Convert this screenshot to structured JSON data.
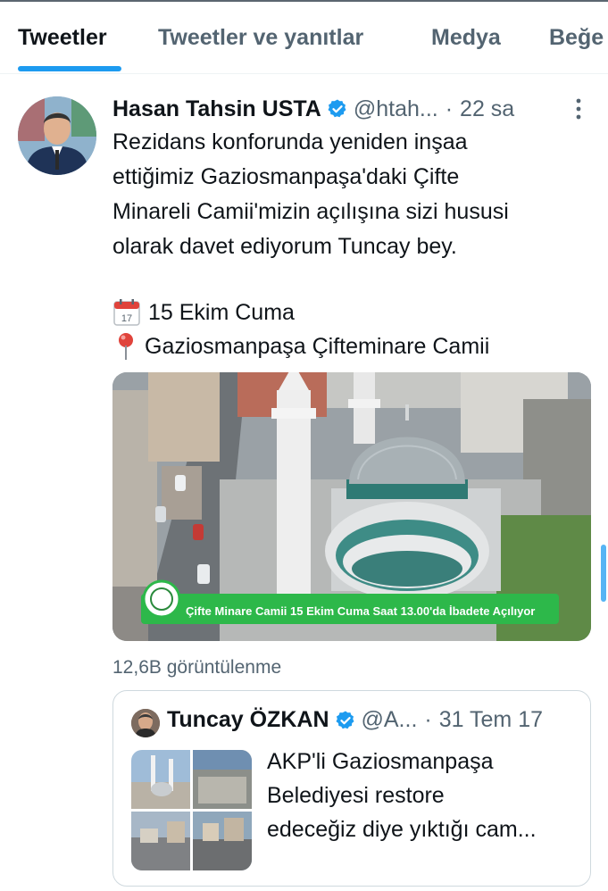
{
  "tabs": [
    {
      "label": "Tweetler"
    },
    {
      "label": "Tweetler ve yanıtlar"
    },
    {
      "label": "Medya"
    },
    {
      "label": "Beğe"
    }
  ],
  "tweet": {
    "author_name": "Hasan Tahsin USTA",
    "handle": "@htah...",
    "separator": "·",
    "time": "22 sa",
    "text_lines": [
      "Rezidans konforunda yeniden inşaa",
      "ettiğimiz Gaziosmanpaşa'daki Çifte",
      "Minareli Camii'mizin açılışına sizi hususi",
      "olarak davet ediyorum Tuncay bey."
    ],
    "date_line": "15 Ekim Cuma",
    "location_line": "Gaziosmanpaşa Çifteminare Camii",
    "media_caption": "Çifte Minare Camii 15 Ekim Cuma Saat 13.00'da İbadete Açılıyor",
    "views": "12,6B görüntülenme",
    "calendar_date_glyph": "17"
  },
  "quote": {
    "author_name": "Tuncay ÖZKAN",
    "handle": "@A...",
    "separator": "·",
    "time": "31 Tem 17",
    "text_lines": [
      "AKP'li Gaziosmanpaşa",
      "Belediyesi restore",
      "edeceğiz diye yıktığı cam..."
    ]
  },
  "colors": {
    "accent": "#1d9bf0",
    "text_primary": "#0f1419",
    "text_secondary": "#536471",
    "border": "#cfd9de",
    "caption_banner": "#2db84a"
  }
}
